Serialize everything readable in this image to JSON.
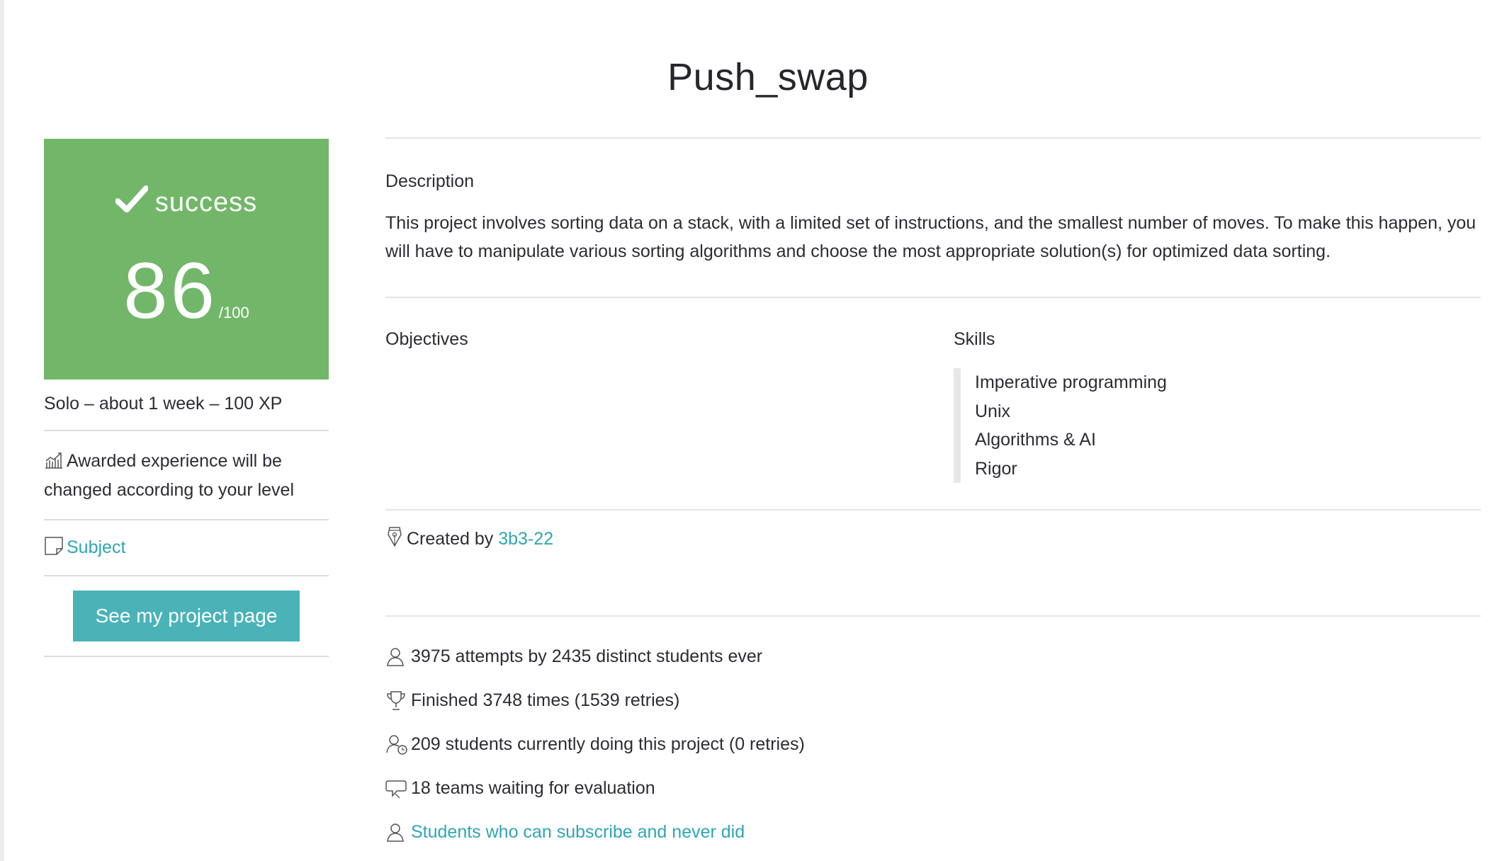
{
  "project": {
    "title": "Push_swap"
  },
  "status": {
    "label": "success",
    "grade": "86",
    "grade_max": "/100",
    "color": "#72b769"
  },
  "sidebar": {
    "meta": "Solo – about 1 week – 100 XP",
    "xp_note": "Awarded experience will be changed according to your level",
    "subject_link": "Subject",
    "project_button": "See my project page"
  },
  "description": {
    "label": "Description",
    "text": "This project involves sorting data on a stack, with a limited set of instructions, and the smallest number of moves. To make this happen, you will have to manipulate various sorting algorithms and choose the most appropriate solution(s) for optimized data sorting."
  },
  "objectives": {
    "label": "Objectives"
  },
  "skills": {
    "label": "Skills",
    "items": [
      "Imperative programming",
      "Unix",
      "Algorithms & AI",
      "Rigor"
    ]
  },
  "creator": {
    "prefix": "Created by",
    "name": "3b3-22"
  },
  "stats": {
    "attempts": "3975 attempts by 2435 distinct students ever",
    "finished": "Finished 3748 times (1539 retries)",
    "current": "209 students currently doing this project (0 retries)",
    "teams": "18 teams waiting for evaluation",
    "subscribe_link": "Students who can subscribe and never did"
  },
  "icons": {
    "status": "checkmark-icon",
    "xp": "chart-icon",
    "subject": "document-icon",
    "creator": "pen-nib-icon",
    "attempts": "user-icon",
    "finished": "trophy-icon",
    "current": "user-clock-icon",
    "teams": "speech-bubble-icon",
    "subscribe": "user-icon"
  },
  "colors": {
    "link": "#2fa6b4",
    "button": "#4ab3b8"
  }
}
